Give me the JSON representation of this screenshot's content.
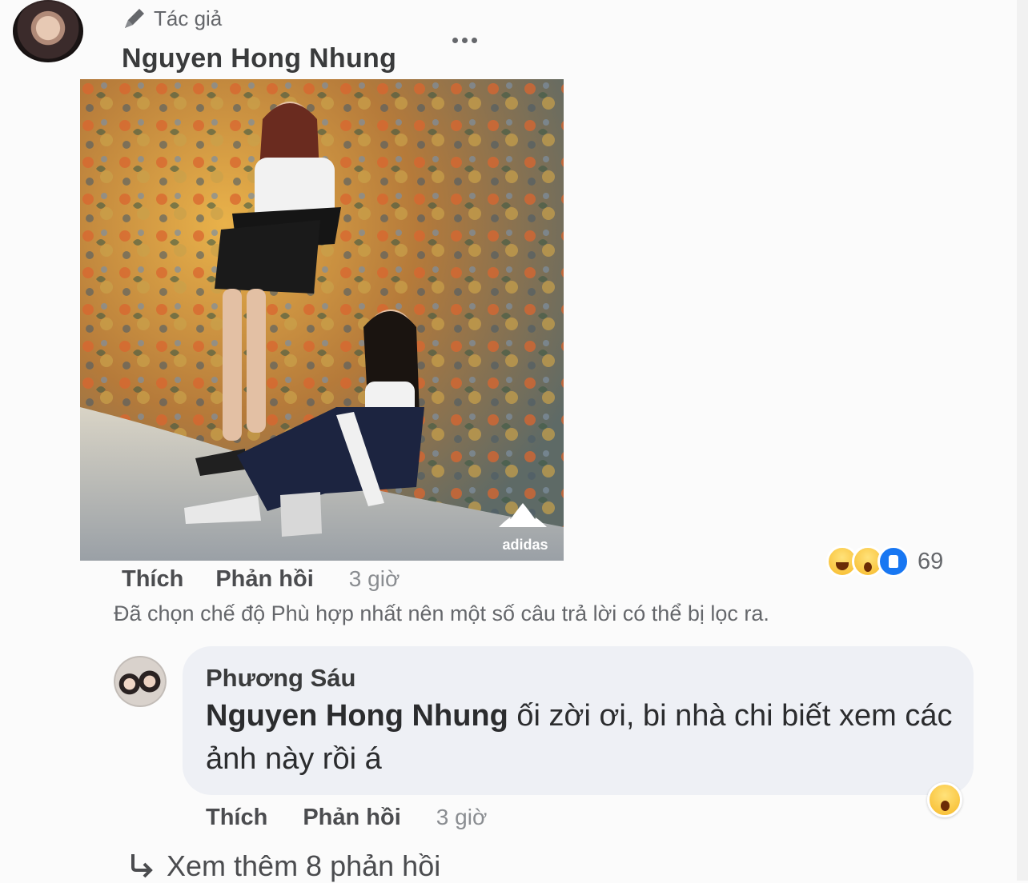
{
  "comment": {
    "author_badge": "Tác giả",
    "author_name": "Nguyen Hong Nhung",
    "actions": {
      "like": "Thích",
      "reply": "Phản hồi",
      "time": "3 giờ"
    },
    "reactions": {
      "icons": [
        "haha-icon",
        "wow-icon",
        "like-icon"
      ],
      "count": "69"
    },
    "photo": {
      "brand_logo_text": "adidas"
    }
  },
  "filter_note": "Đã chọn chế độ Phù hợp nhất nên một số câu trả lời có thể bị lọc ra.",
  "reply": {
    "author_name": "Phương Sáu",
    "mention": "Nguyen Hong Nhung",
    "text": " ối zời ơi, bi nhà chi biết xem các ảnh này rồi á",
    "actions": {
      "like": "Thích",
      "reply": "Phản hồi",
      "time": "3 giờ"
    },
    "reaction_icon": "wow-icon"
  },
  "more_replies": "Xem thêm 8 phản hồi",
  "colors": {
    "bubble": "#eef0f5",
    "text": "#1c1e21",
    "muted": "#65676b"
  }
}
